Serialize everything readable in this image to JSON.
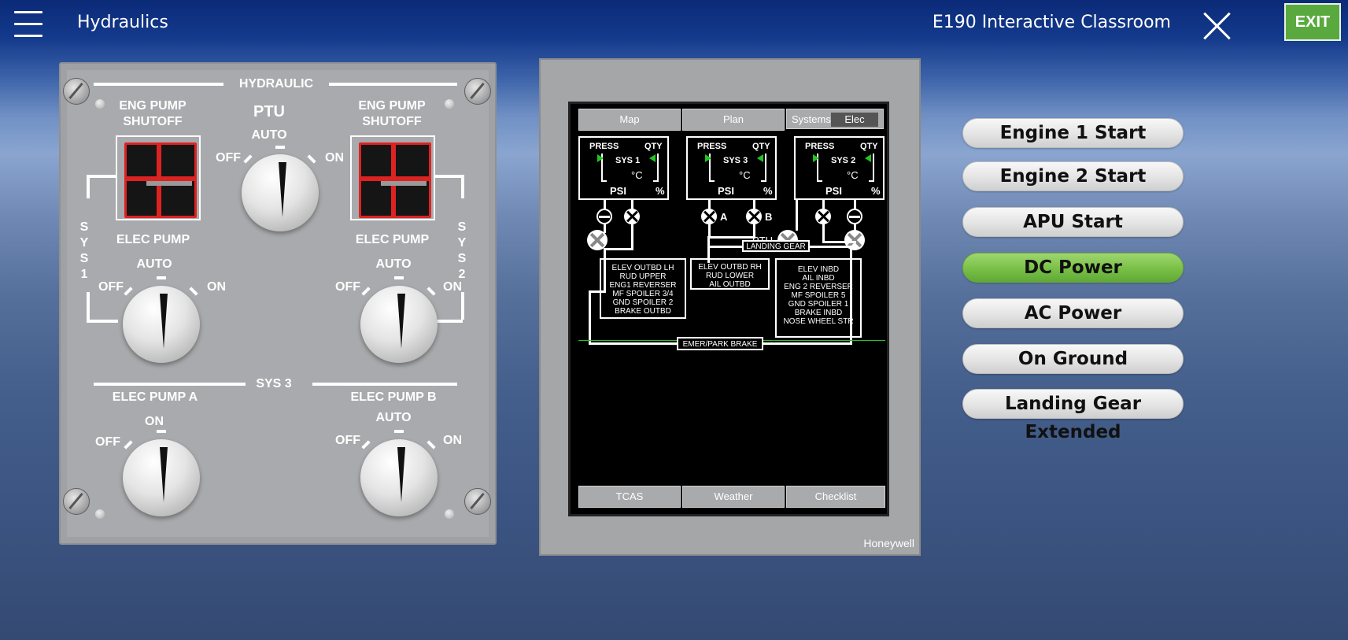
{
  "header": {
    "page_title": "Hydraulics",
    "app_title": "E190 Interactive Classroom",
    "exit_label": "EXIT"
  },
  "hydraulic_panel": {
    "title": "HYDRAULIC",
    "eng_pump_shutoff_left": "ENG PUMP\nSHUTOFF",
    "eng_pump_shutoff_right": "ENG PUMP\nSHUTOFF",
    "ptu": {
      "label": "PTU",
      "auto": "AUTO",
      "off": "OFF",
      "on": "ON"
    },
    "sys1_label": "SYS1",
    "sys2_label": "SYS2",
    "elec_pump_left": {
      "label": "ELEC PUMP",
      "auto": "AUTO",
      "off": "OFF",
      "on": "ON"
    },
    "elec_pump_right": {
      "label": "ELEC PUMP",
      "auto": "AUTO",
      "off": "OFF",
      "on": "ON"
    },
    "sys3_label": "SYS 3",
    "elec_pump_a": {
      "label": "ELEC PUMP A",
      "on": "ON",
      "off": "OFF"
    },
    "elec_pump_b": {
      "label": "ELEC PUMP B",
      "auto": "AUTO",
      "off": "OFF",
      "on": "ON"
    }
  },
  "display": {
    "top_tabs": [
      "Map",
      "Plan",
      "Systems"
    ],
    "systems_sub": "Elec",
    "bottom_tabs": [
      "TCAS",
      "Weather",
      "Checklist"
    ],
    "brand": "Honeywell",
    "sys_boxes": [
      {
        "name": "SYS 1",
        "press": "PRESS",
        "qty": "QTY",
        "temp": "°C",
        "psi": "PSI",
        "pct": "%"
      },
      {
        "name": "SYS 3",
        "press": "PRESS",
        "qty": "QTY",
        "temp": "°C",
        "psi": "PSI",
        "pct": "%"
      },
      {
        "name": "SYS 2",
        "press": "PRESS",
        "qty": "QTY",
        "temp": "°C",
        "psi": "PSI",
        "pct": "%"
      }
    ],
    "valve_a": "A",
    "valve_b": "B",
    "ptu_label": "PTU",
    "landing_gear": "LANDING GEAR",
    "emer_park_brake": "EMER/PARK BRAKE",
    "consumers_sys1": [
      "ELEV OUTBD LH",
      "RUD UPPER",
      "ENG1 REVERSER",
      "MF SPOILER 3/4",
      "GND SPOILER 2",
      "BRAKE OUTBD"
    ],
    "consumers_sys3": [
      "ELEV OUTBD RH",
      "RUD LOWER",
      "AIL OUTBD"
    ],
    "consumers_sys2": [
      "ELEV INBD",
      "AIL INBD",
      "ENG 2 REVERSER",
      "MF SPOILER 5",
      "GND SPOILER 1",
      "BRAKE INBD",
      "NOSE WHEEL STR"
    ]
  },
  "actions": [
    {
      "label": "Engine 1 Start",
      "active": false
    },
    {
      "label": "Engine 2 Start",
      "active": false
    },
    {
      "label": "APU Start",
      "active": false
    },
    {
      "label": "DC Power",
      "active": true
    },
    {
      "label": "AC Power",
      "active": false
    },
    {
      "label": "On Ground",
      "active": false
    },
    {
      "label": "Landing Gear Extended",
      "active": false
    }
  ],
  "colors": {
    "active_button": "#7cc24a",
    "exit_button": "#5aa93f",
    "pump_shutoff_red": "#dd2222",
    "eicas_green": "#22c422"
  }
}
